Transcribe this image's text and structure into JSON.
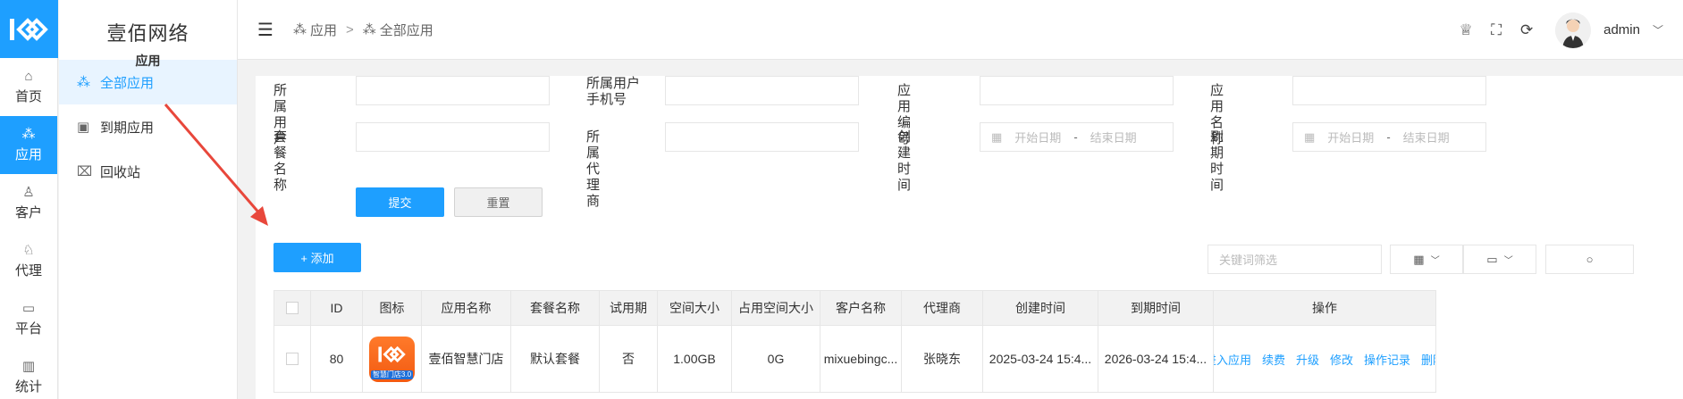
{
  "rail": {
    "items": [
      {
        "label": "首页",
        "icon": "home-icon",
        "glyph": "⌂"
      },
      {
        "label": "应用",
        "icon": "apps-icon",
        "glyph": "⁂"
      },
      {
        "label": "客户",
        "icon": "user-icon",
        "glyph": "♙"
      },
      {
        "label": "代理",
        "icon": "agent-icon",
        "glyph": "♘"
      },
      {
        "label": "平台",
        "icon": "monitor-icon",
        "glyph": "▭"
      },
      {
        "label": "统计",
        "icon": "bar-chart-icon",
        "glyph": "▥"
      }
    ]
  },
  "brand": {
    "name": "壹佰网络",
    "section": "应用"
  },
  "subnav": {
    "items": [
      {
        "label": "全部应用",
        "icon": "apps-icon",
        "glyph": "⁂"
      },
      {
        "label": "到期应用",
        "icon": "expire-icon",
        "glyph": "▣"
      },
      {
        "label": "回收站",
        "icon": "trash-icon",
        "glyph": "🗑"
      }
    ]
  },
  "breadcrumb": {
    "first": "应用",
    "second": "全部应用",
    "sep": ">"
  },
  "user": {
    "name": "admin"
  },
  "form": {
    "owner_user": "所属用户",
    "owner_phone": "所属用户手机号",
    "app_no": "应用编号",
    "app_name": "应用名称",
    "plan_name": "套餐名称",
    "agent": "所属代理商",
    "created": "创建时间",
    "expire": "到期时间",
    "start_placeholder": "开始日期",
    "end_placeholder": "结束日期",
    "submit": "提交",
    "reset": "重置"
  },
  "toolbar": {
    "add": "+ 添加",
    "keyword_placeholder": "关键词筛选"
  },
  "table": {
    "headers": [
      "ID",
      "图标",
      "应用名称",
      "套餐名称",
      "试用期",
      "空间大小",
      "占用空间大小",
      "客户名称",
      "代理商",
      "创建时间",
      "到期时间",
      "操作"
    ],
    "rows": [
      {
        "id": "80",
        "icon_caption": "智慧门店3.0",
        "app_name": "壹佰智慧门店",
        "plan": "默认套餐",
        "trial": "否",
        "space": "1.00GB",
        "used": "0G",
        "customer": "mixuebingc...",
        "agent": "张晓东",
        "created": "2025-03-24 15:4...",
        "expire": "2026-03-24 15:4...",
        "actions": [
          "进入应用",
          "续费",
          "升级",
          "修改",
          "操作记录",
          "删除"
        ]
      }
    ]
  },
  "colors": {
    "accent": "#1e9fff",
    "arrow": "#e8473b"
  }
}
